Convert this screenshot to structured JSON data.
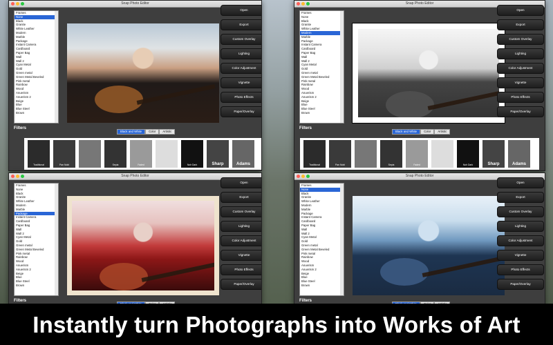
{
  "app": {
    "title": "Snap Photo Editor"
  },
  "frames_list": [
    "Frames",
    "None",
    "Black",
    "Granite",
    "White Leather",
    "Modern",
    "Marble",
    "Package",
    "Instant Camera",
    "Cardboard",
    "Paper Bag",
    "Wall",
    "Wall 2",
    "Cyan Metal",
    "Gold",
    "Green metal",
    "Green Metal Beveled",
    "Pink metal",
    "Rainbow",
    "Wood",
    "Anuerism",
    "Anuerism 2",
    "Beige",
    "Blue",
    "Blue Steel",
    "Brown"
  ],
  "windows": [
    {
      "selected": "None"
    },
    {
      "selected": "Modern"
    },
    {
      "selected": "Package"
    },
    {
      "selected": "None"
    }
  ],
  "buttons": [
    "Open",
    "Export",
    "Custom Overlay",
    "Lighting",
    "Color Adjustment",
    "Vignette",
    "Photo Effects",
    "Paper/Overlay"
  ],
  "filters_label": "Filters",
  "filter_tabs": [
    "Black and White",
    "Color",
    "Artistic"
  ],
  "thumbs": [
    "Traditional",
    "Pan Nobl",
    "",
    "Sepia",
    "Faded",
    "",
    "Nolr Dark",
    "Sharp",
    "Adams"
  ],
  "banner": "Instantly turn Photographs into Works of Art"
}
